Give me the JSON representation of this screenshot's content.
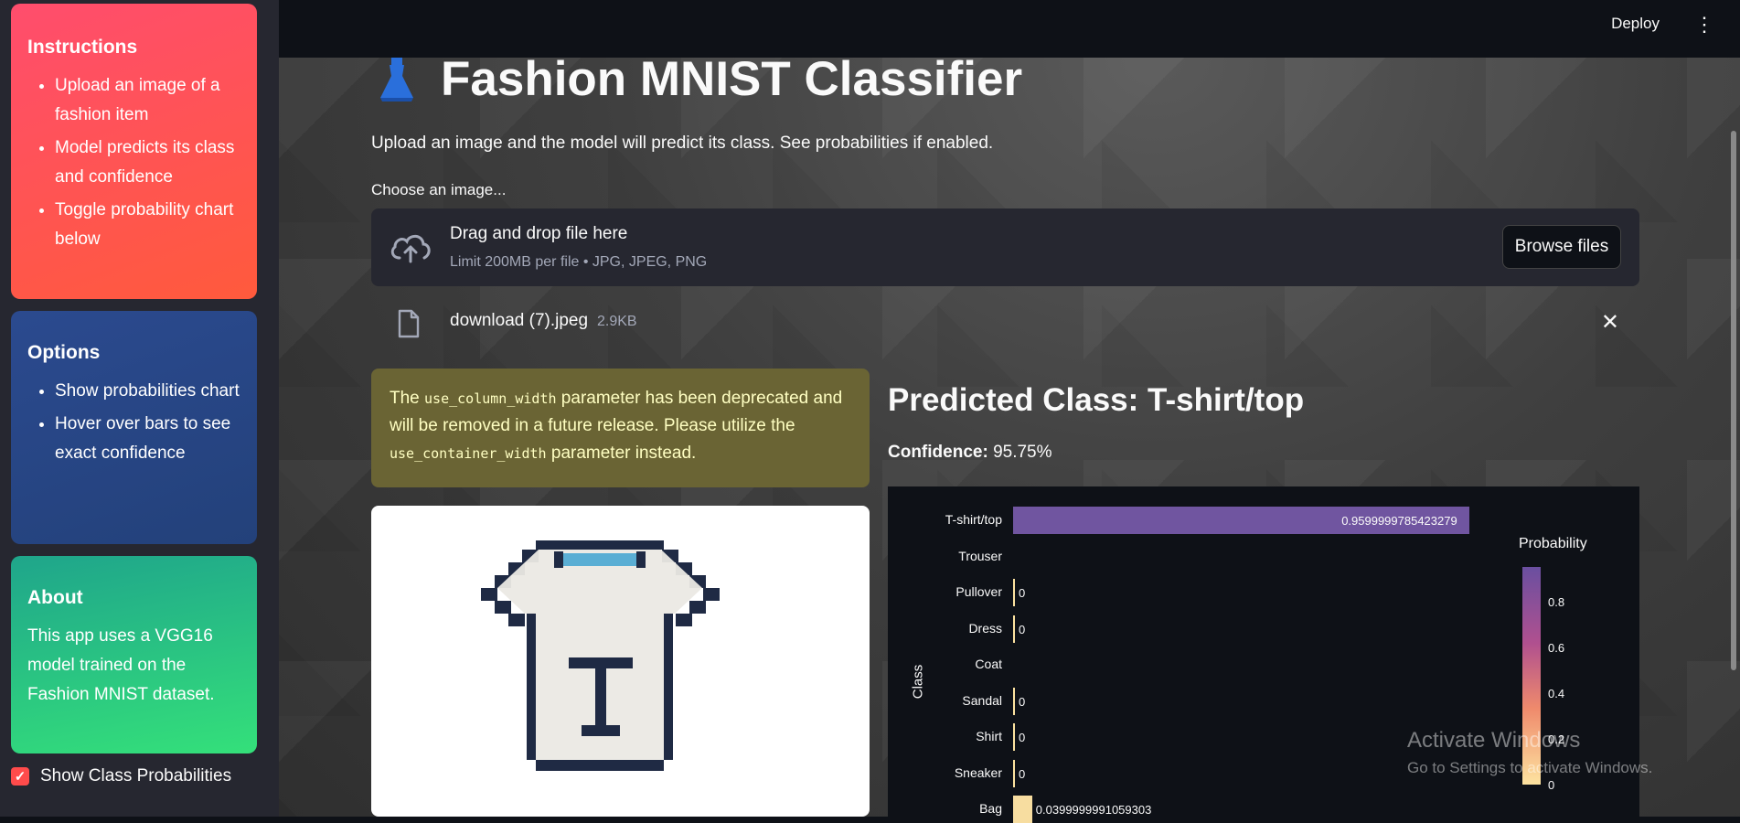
{
  "sidebar": {
    "instructions": {
      "title": "Instructions",
      "items": [
        "Upload an image of a fashion item",
        "Model predicts its class and confidence",
        "Toggle probability chart below"
      ]
    },
    "options": {
      "title": "Options",
      "items": [
        "Show probabilities chart",
        "Hover over bars to see exact confidence"
      ]
    },
    "about": {
      "title": "About",
      "text": "This app uses a VGG16 model trained on the Fashion MNIST dataset."
    },
    "checkbox_label": "Show Class Probabilities",
    "checkbox_checked": true
  },
  "header": {
    "deploy_label": "Deploy",
    "menu_icon": "vertical-dots-icon"
  },
  "main": {
    "title": "Fashion MNIST Classifier",
    "subtitle": "Upload an image and the model will predict its class. See probabilities if enabled.",
    "uploader": {
      "label": "Choose an image...",
      "drop_title": "Drag and drop file here",
      "drop_sub": "Limit 200MB per file • JPG, JPEG, PNG",
      "browse_label": "Browse files"
    },
    "file": {
      "name": "download (7).jpeg",
      "size": "2.9KB"
    },
    "warning": {
      "pre": "The ",
      "code1": "use_column_width",
      "mid": " parameter has been deprecated and will be removed in a future release. Please utilize the ",
      "code2": "use_container_width",
      "post": " parameter instead."
    },
    "prediction": {
      "title": "Predicted Class: T-shirt/top",
      "confidence_label": "Confidence:",
      "confidence_value": "95.75%"
    }
  },
  "chart_data": {
    "type": "bar",
    "orientation": "horizontal",
    "ylabel": "Class",
    "categories": [
      "T-shirt/top",
      "Trouser",
      "Pullover",
      "Dress",
      "Coat",
      "Sandal",
      "Shirt",
      "Sneaker",
      "Bag"
    ],
    "values": [
      0.9599999785423279,
      null,
      0,
      0,
      null,
      0,
      0,
      0,
      0.0399999991059303
    ],
    "value_labels": [
      "0.9599999785423279",
      "",
      "0",
      "0",
      "",
      "0",
      "0",
      "0",
      "0.0399999991059303"
    ],
    "legend_title": "Probability",
    "legend_ticks": [
      "0.8",
      "0.6",
      "0.4",
      "0.2",
      "0"
    ],
    "colors": {
      "high": "#6a4fa0",
      "low": "#fde3a0"
    }
  },
  "watermark": {
    "line1": "Activate Windows",
    "line2": "Go to Settings to activate Windows."
  }
}
